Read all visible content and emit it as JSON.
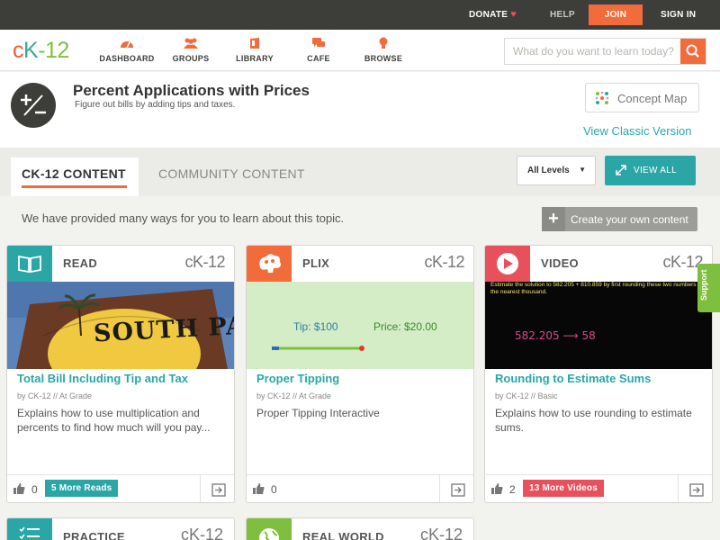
{
  "topbar": {
    "donate": "DONATE",
    "help": "HELP",
    "join": "JOIN",
    "signin": "SIGN IN"
  },
  "logo": {
    "c": "c",
    "k": "K",
    "n": "-12"
  },
  "nav": {
    "items": [
      {
        "label": "DASHBOARD",
        "icon": "gauge-icon"
      },
      {
        "label": "GROUPS",
        "icon": "people-icon"
      },
      {
        "label": "LIBRARY",
        "icon": "library-icon"
      },
      {
        "label": "CAFE",
        "icon": "chat-icon"
      },
      {
        "label": "BROWSE",
        "icon": "bulb-icon"
      }
    ],
    "search_placeholder": "What do you want to learn today?"
  },
  "page": {
    "title": "Percent Applications with Prices",
    "subtitle": "Figure out bills by adding tips and taxes.",
    "concept_map": "Concept Map",
    "classic": "View Classic Version"
  },
  "tabs": {
    "active": "CK-12 CONTENT",
    "community": "COMMUNITY CONTENT",
    "levels": "All Levels",
    "view_all": "VIEW ALL"
  },
  "intro": {
    "text": "We have provided many ways for you to learn about this topic.",
    "create": "Create your own content"
  },
  "brandmark": "cK-12",
  "cards": [
    {
      "type": "READ",
      "title": "Total Bill Including Tip and Tax",
      "meta": "by CK-12 // At Grade",
      "desc": "Explains how to use multiplication and percents to find how much will you pay...",
      "likes": "0",
      "more": "5 More Reads",
      "image_text": "SOUTH PACIFIC",
      "color": "#2aa6a7"
    },
    {
      "type": "PLIX",
      "title": "Proper Tipping",
      "meta": "by CK-12 // At Grade",
      "desc": "Proper Tipping Interactive",
      "likes": "0",
      "tip": "Tip: $100",
      "price": "Price: $20.00",
      "color": "#f26b3a"
    },
    {
      "type": "VIDEO",
      "title": "Rounding to Estimate Sums",
      "meta": "by CK-12 // Basic",
      "desc": "Explains how to use rounding to estimate sums.",
      "likes": "2",
      "more": "13 More Videos",
      "video_text": "Estimate the solution to 582.205 + 810.859 by first rounding these two numbers to the nearest thousand.",
      "video_note": "582.205 ⟶ 58",
      "color": "#e8505b"
    }
  ],
  "cards_row2": [
    {
      "type": "PRACTICE",
      "color": "#2aa6a7"
    },
    {
      "type": "REAL WORLD",
      "color": "#7fbf3f"
    }
  ],
  "support": "Support"
}
